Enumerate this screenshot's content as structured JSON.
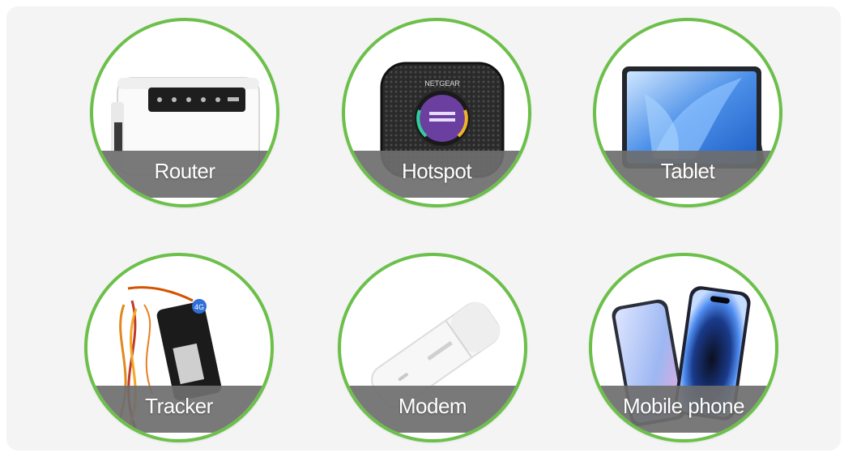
{
  "theme": {
    "ring_color": "#6cc04a",
    "band_color": "#6e6e6e",
    "panel_bg": "#f4f4f4"
  },
  "devices": [
    {
      "label": "Router",
      "icon": "router-icon"
    },
    {
      "label": "Hotspot",
      "icon": "hotspot-icon",
      "brand_text": "NETGEAR"
    },
    {
      "label": "Tablet",
      "icon": "tablet-icon"
    },
    {
      "label": "Tracker",
      "icon": "tracker-icon",
      "badge_text": "4G"
    },
    {
      "label": "Modem",
      "icon": "usb-modem-icon"
    },
    {
      "label": "Mobile phone",
      "icon": "mobile-phone-icon"
    }
  ]
}
